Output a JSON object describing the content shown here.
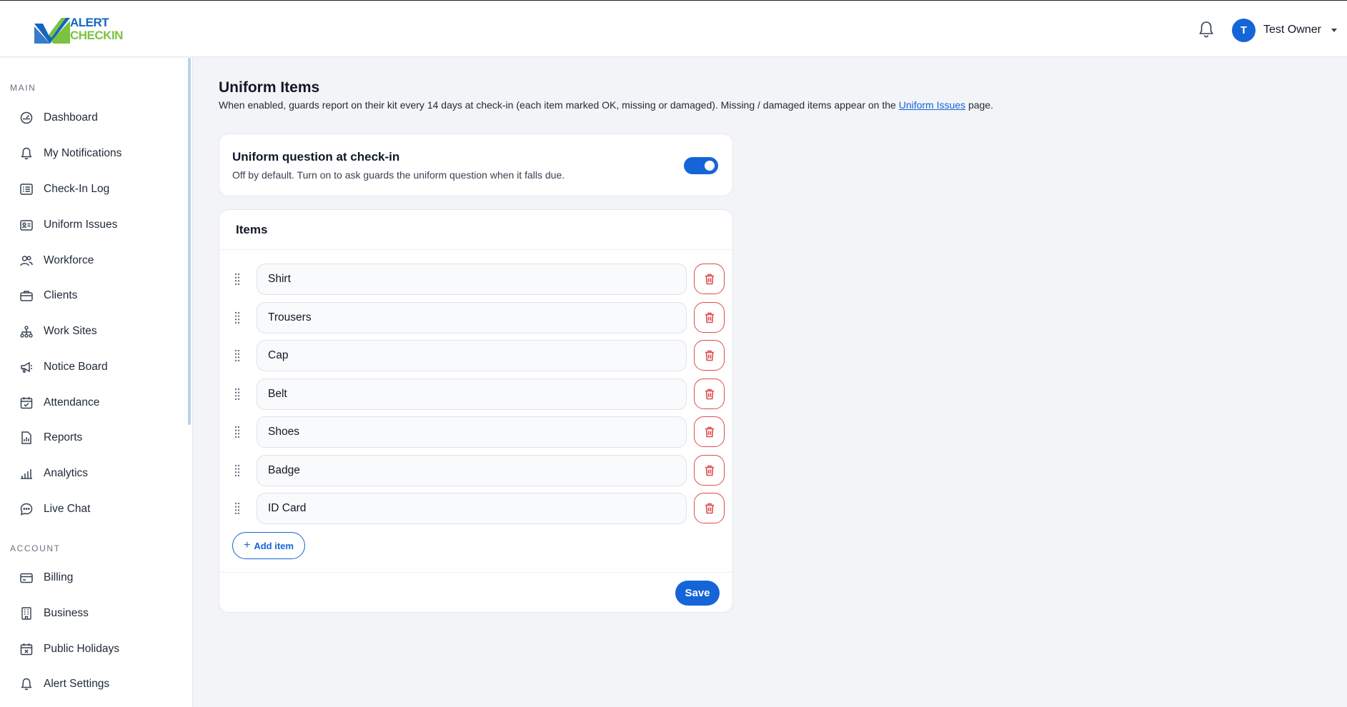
{
  "brand": {
    "line1": "ALERT",
    "line2": "CHECKIN",
    "primary_color": "#1565c0",
    "secondary_color": "#7cc242"
  },
  "header": {
    "notifications_icon": "bell-icon",
    "user": {
      "initial": "T",
      "name": "Test Owner",
      "avatar_color": "#1565d8"
    }
  },
  "sidebar": {
    "main_heading": "MAIN",
    "main_items": [
      {
        "label": "Dashboard",
        "icon": "gauge-icon"
      },
      {
        "label": "My Notifications",
        "icon": "bell-icon"
      },
      {
        "label": "Check-In Log",
        "icon": "list-icon"
      },
      {
        "label": "Uniform Issues",
        "icon": "id-card-icon"
      },
      {
        "label": "Workforce",
        "icon": "users-icon"
      },
      {
        "label": "Clients",
        "icon": "briefcase-icon"
      },
      {
        "label": "Work Sites",
        "icon": "sitemap-icon"
      },
      {
        "label": "Notice Board",
        "icon": "megaphone-icon"
      },
      {
        "label": "Attendance",
        "icon": "calendar-check-icon"
      },
      {
        "label": "Reports",
        "icon": "report-icon"
      },
      {
        "label": "Analytics",
        "icon": "bar-chart-icon"
      },
      {
        "label": "Live Chat",
        "icon": "chat-icon"
      }
    ],
    "account_heading": "ACCOUNT",
    "account_items": [
      {
        "label": "Billing",
        "icon": "credit-card-icon"
      },
      {
        "label": "Business",
        "icon": "building-icon"
      },
      {
        "label": "Public Holidays",
        "icon": "calendar-x-icon"
      },
      {
        "label": "Alert Settings",
        "icon": "bell-icon"
      }
    ]
  },
  "page": {
    "title": "Uniform Items",
    "description_before": "When enabled, guards report on their kit every 14 days at check-in (each item marked OK, missing or damaged). Missing / damaged items appear on the ",
    "description_link": "Uniform Issues",
    "description_after": " page."
  },
  "uniform_toggle": {
    "title": "Uniform question at check-in",
    "subtitle": "Off by default. Turn on to ask guards the uniform question when it falls due.",
    "enabled": true
  },
  "items_card": {
    "title": "Items",
    "items": [
      "Shirt",
      "Trousers",
      "Cap",
      "Belt",
      "Shoes",
      "Badge",
      "ID Card"
    ],
    "add_label": "Add item",
    "save_label": "Save",
    "delete_color": "#e04b4b"
  }
}
